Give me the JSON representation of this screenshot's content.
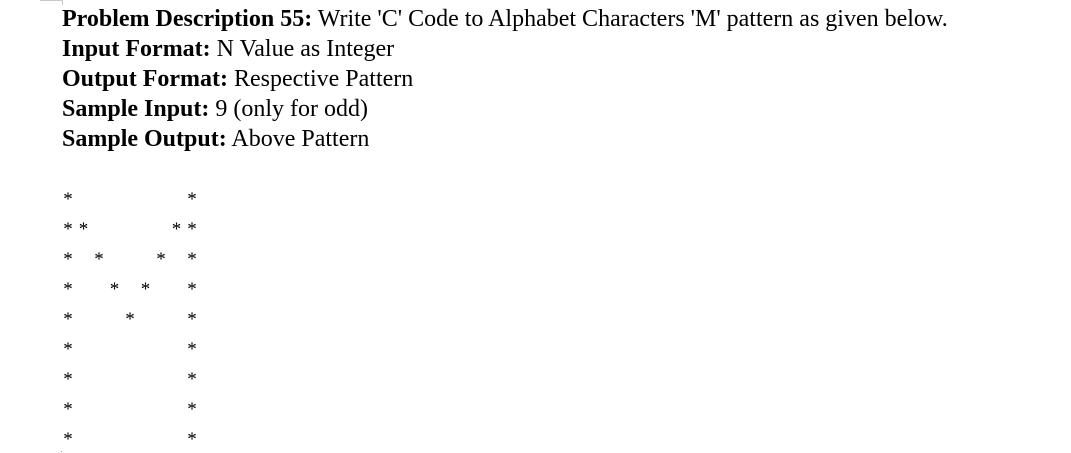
{
  "problem": {
    "description_label": "Problem Description 55:",
    "description_text": " Write 'C' Code to Alphabet Characters 'M' pattern as given below.",
    "input_label": "Input Format:",
    "input_text": " N Value as Integer",
    "output_label": "Output Format:",
    "output_text": " Respective Pattern",
    "sample_input_label": "Sample Input:",
    "sample_input_text": " 9 (only for odd)",
    "sample_output_label": "Sample Output:",
    "sample_output_text": " Above Pattern"
  },
  "pattern": {
    "symbol": "*",
    "size": 9,
    "rows": [
      [
        0,
        8
      ],
      [
        0,
        1,
        7,
        8
      ],
      [
        0,
        2,
        6,
        8
      ],
      [
        0,
        3,
        5,
        8
      ],
      [
        0,
        4,
        8
      ],
      [
        0,
        8
      ],
      [
        0,
        8
      ],
      [
        0,
        8
      ],
      [
        0,
        8
      ]
    ]
  }
}
